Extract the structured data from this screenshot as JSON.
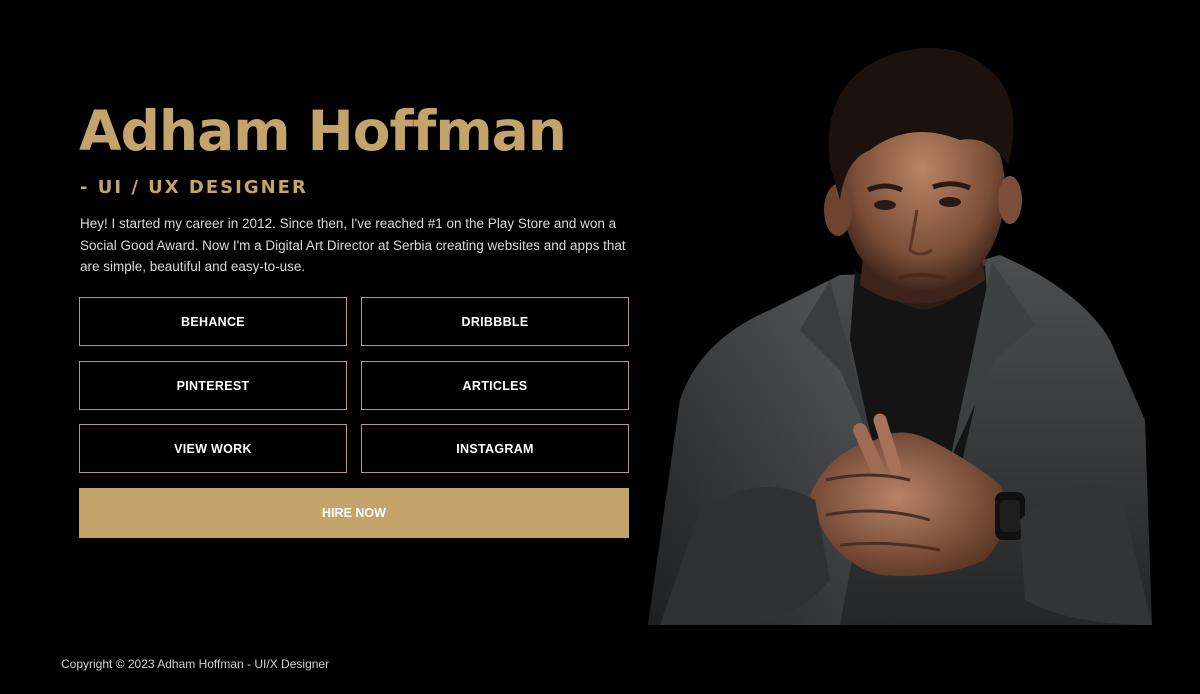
{
  "hero": {
    "name": "Adham Hoffman",
    "role": "- UI / UX DESIGNER",
    "bio": "Hey! I started my career in 2012. Since then, I've reached #1 on the Play Store and won a Social Good Award. Now I'm a Digital Art Director at Serbia creating websites and apps that are simple, beautiful and easy-to-use."
  },
  "links": {
    "behance": "BEHANCE",
    "dribbble": "DRIBBBLE",
    "pinterest": "PINTEREST",
    "articles": "ARTICLES",
    "view_work": "VIEW WORK",
    "instagram": "INSTAGRAM"
  },
  "cta": {
    "hire_label": "HIRE NOW"
  },
  "footer": {
    "copyright": "Copyright © 2023 Adham Hoffman - UI/X Designer"
  },
  "colors": {
    "background": "#000000",
    "accent": "#c4a46a",
    "button_border": "#b99a6c",
    "text": "#d8d8d8"
  }
}
